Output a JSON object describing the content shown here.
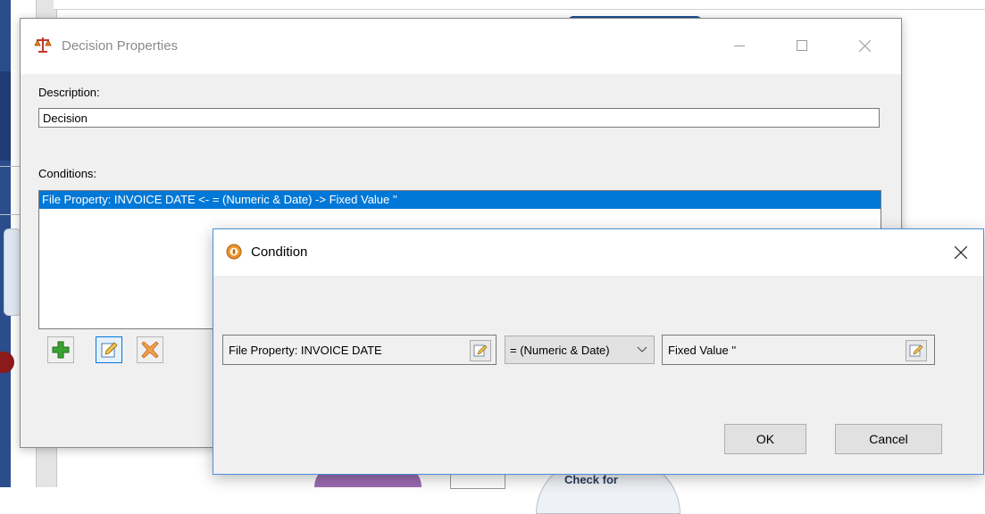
{
  "background": {
    "node_label": "Check for"
  },
  "decision_window": {
    "title": "Decision Properties",
    "title_icon": "scales-icon",
    "description_label": "Description:",
    "description_value": "Decision",
    "conditions_label": "Conditions:",
    "conditions": [
      "File Property: INVOICE DATE <- = (Numeric & Date) -> Fixed Value ''"
    ],
    "toolbar_icons": [
      "add-icon",
      "edit-icon",
      "delete-icon"
    ]
  },
  "condition_dialog": {
    "title": "Condition",
    "title_icon": "info-circle-icon",
    "left_operand": "File Property: INVOICE DATE",
    "operator": "= (Numeric & Date)",
    "right_operand": "Fixed Value ''",
    "ok_label": "OK",
    "cancel_label": "Cancel"
  },
  "colors": {
    "selection": "#0078d7",
    "dialog_border": "#4a90d9",
    "add_icon": "#3aa335",
    "delete_icon": "#e8741a"
  }
}
